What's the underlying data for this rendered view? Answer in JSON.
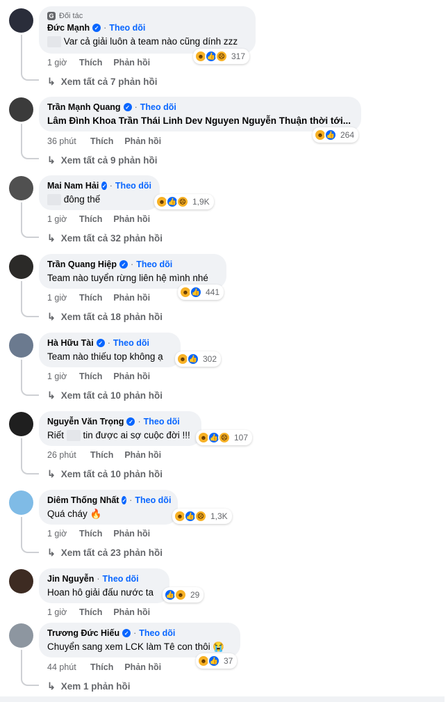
{
  "labels": {
    "follow": "Theo dõi",
    "like": "Thích",
    "reply": "Phản hồi",
    "partner": "Đối tác",
    "dot": "·"
  },
  "colors": {
    "link": "#0866ff",
    "muted": "#65676b",
    "bubble": "#f0f2f5"
  },
  "comments": [
    {
      "partner": true,
      "name": "Đức Mạnh",
      "text": "Var cả giải luôn à team nào cũng dính zzz",
      "blur_prefix": true,
      "reactions": [
        "haha",
        "like",
        "sad"
      ],
      "count": "317",
      "time": "1 giờ",
      "replies": "Xem tất cả 7 phản hồi"
    },
    {
      "name": "Trần Mạnh Quang",
      "text": "Lâm Đình Khoa Trần Thái Linh Dev Nguyen Nguyễn Thuận thời tới...",
      "reactions": [
        "haha",
        "like"
      ],
      "count": "264",
      "time": "36 phút",
      "replies": "Xem tất cả 9 phản hồi"
    },
    {
      "name": "Mai Nam Hải",
      "text": "đông thế",
      "blur_prefix": true,
      "reactions": [
        "haha",
        "like",
        "sad"
      ],
      "count": "1,9K",
      "time": "1 giờ",
      "replies": "Xem tất cả 32 phản hồi"
    },
    {
      "name": "Trần Quang Hiệp",
      "text": "Team nào tuyển rừng liên hệ mình nhé",
      "reactions": [
        "haha",
        "like"
      ],
      "count": "441",
      "time": "1 giờ",
      "replies": "Xem tất cả 18 phản hồi"
    },
    {
      "name": "Hà Hữu Tài",
      "text": "Team nào thiếu top không ạ",
      "reactions": [
        "haha",
        "like"
      ],
      "count": "302",
      "time": "1 giờ",
      "replies": "Xem tất cả 10 phản hồi"
    },
    {
      "name": "Nguyễn Văn Trọng",
      "text_a": "Riết",
      "text_b": "tin được ai sợ cuộc đời !!!",
      "reactions": [
        "haha",
        "like",
        "sad"
      ],
      "count": "107",
      "time": "26 phút",
      "replies": "Xem tất cả 10 phản hồi"
    },
    {
      "name": "Diêm Thống Nhất",
      "text": "Quá cháy 🔥",
      "reactions": [
        "haha",
        "like",
        "sad"
      ],
      "count": "1,3K",
      "time": "1 giờ",
      "replies": "Xem tất cả 23 phản hồi"
    },
    {
      "name": "Jin Nguyễn",
      "text": "Hoan hô giải đấu nước ta",
      "reactions": [
        "like",
        "haha"
      ],
      "count": "29",
      "time": "1 giờ",
      "replies": ""
    },
    {
      "name": "Trương Đức Hiếu",
      "text": "Chuyển sang xem LCK làm Tê con thôi 😭",
      "reactions": [
        "haha",
        "like"
      ],
      "count": "37",
      "time": "44 phút",
      "replies": "Xem 1 phản hồi"
    }
  ]
}
